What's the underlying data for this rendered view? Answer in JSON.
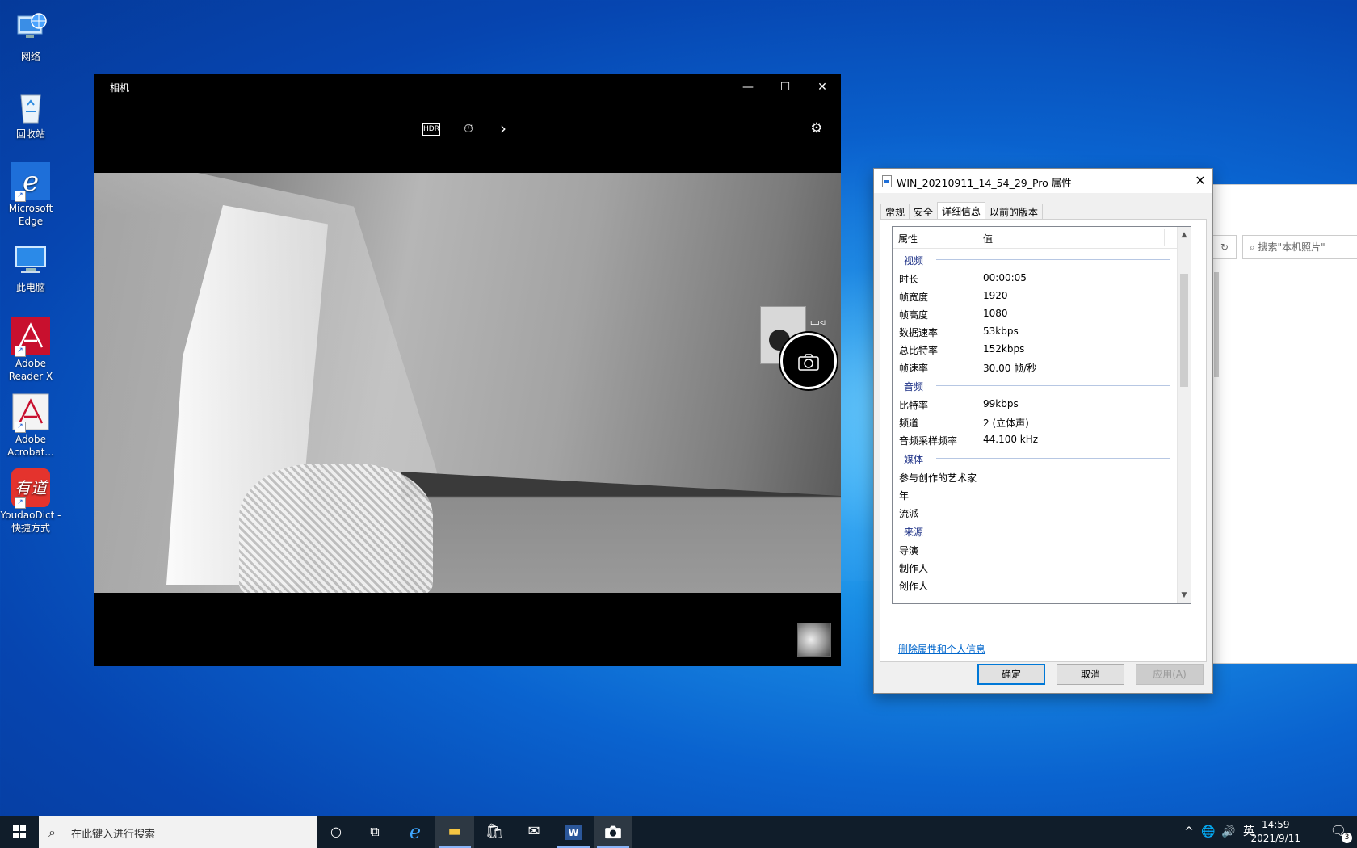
{
  "desktop": {
    "icons": [
      {
        "label": "网络",
        "icon": "network-icon"
      },
      {
        "label": "回收站",
        "icon": "recycle-bin-icon"
      },
      {
        "label": "Microsoft Edge",
        "icon": "edge-icon"
      },
      {
        "label": "此电脑",
        "icon": "this-pc-icon"
      },
      {
        "label": "Adobe Reader X",
        "icon": "adobe-reader-icon"
      },
      {
        "label": "Adobe Acrobat...",
        "icon": "adobe-acrobat-icon"
      },
      {
        "label": "YoudaoDict - 快捷方式",
        "icon": "youdao-icon"
      }
    ],
    "youdao_logo_text": "有道"
  },
  "camera": {
    "title": "相机",
    "minimize": "—",
    "maximize": "☐",
    "close": "✕",
    "tools": {
      "hdr": "HDR",
      "timer": "⏱",
      "more": "›",
      "settings": "⚙"
    },
    "video_mode": "▭◃",
    "shutter": "📷"
  },
  "explorer": {
    "search_placeholder": "搜索\"本机照片\"",
    "refresh": "↻"
  },
  "properties": {
    "title": "WIN_20210911_14_54_29_Pro 属性",
    "close": "✕",
    "tabs": [
      "常规",
      "安全",
      "详细信息",
      "以前的版本"
    ],
    "active_tab": "详细信息",
    "col_property": "属性",
    "col_value": "值",
    "groups": [
      {
        "name": "视频",
        "rows": [
          {
            "k": "时长",
            "v": "00:00:05"
          },
          {
            "k": "帧宽度",
            "v": "1920"
          },
          {
            "k": "帧高度",
            "v": "1080"
          },
          {
            "k": "数据速率",
            "v": "53kbps"
          },
          {
            "k": "总比特率",
            "v": "152kbps"
          },
          {
            "k": "帧速率",
            "v": "30.00 帧/秒"
          }
        ]
      },
      {
        "name": "音频",
        "rows": [
          {
            "k": "比特率",
            "v": "99kbps"
          },
          {
            "k": "频道",
            "v": "2 (立体声)"
          },
          {
            "k": "音频采样频率",
            "v": "44.100 kHz"
          }
        ]
      },
      {
        "name": "媒体",
        "rows": [
          {
            "k": "参与创作的艺术家",
            "v": ""
          },
          {
            "k": "年",
            "v": ""
          },
          {
            "k": "流派",
            "v": ""
          }
        ]
      },
      {
        "name": "来源",
        "rows": [
          {
            "k": "导演",
            "v": ""
          },
          {
            "k": "制作人",
            "v": ""
          },
          {
            "k": "创作人",
            "v": ""
          }
        ]
      }
    ],
    "remove_link": "删除属性和个人信息",
    "ok": "确定",
    "cancel": "取消",
    "apply": "应用(A)"
  },
  "taskbar": {
    "search_placeholder": "在此键入进行搜索",
    "tray": {
      "chevron": "^",
      "network": "🌐",
      "volume": "🔊",
      "ime": "英"
    },
    "time": "14:59",
    "date": "2021/9/11",
    "notification_count": "3"
  }
}
